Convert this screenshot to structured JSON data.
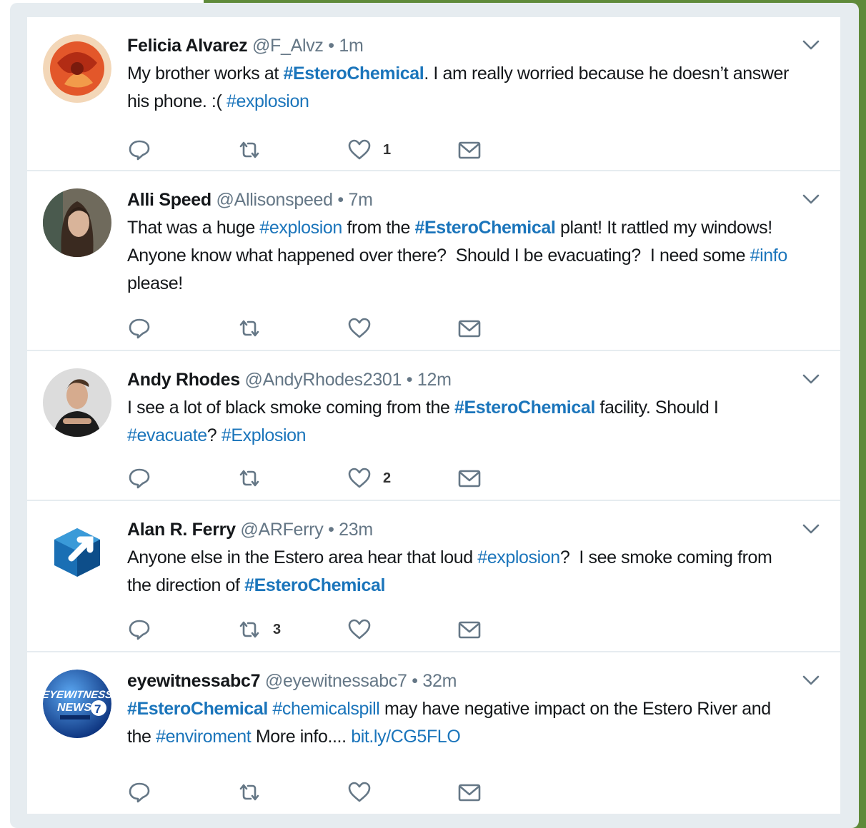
{
  "tweets": [
    {
      "name": "Felicia Alvarez",
      "handle": "@F_Alvz",
      "time": "1m",
      "text": [
        {
          "t": "My brother works at "
        },
        {
          "t": "#EsteroChemical",
          "tag": "bold"
        },
        {
          "t": ". I am really worried because he doesn’t answer his phone. :( "
        },
        {
          "t": "#explosion",
          "tag": "normal"
        }
      ],
      "reply_count": "",
      "retweet_count": "",
      "like_count": "1",
      "avatar": "red-flower-avatar"
    },
    {
      "name": "Alli Speed",
      "handle": "@Allisonspeed",
      "time": "7m",
      "text": [
        {
          "t": "That was a huge "
        },
        {
          "t": "#explosion",
          "tag": "normal"
        },
        {
          "t": " from the "
        },
        {
          "t": "#EsteroChemical",
          "tag": "bold"
        },
        {
          "t": " plant! It rattled my windows!  Anyone know what happened over there?  Should I be evacuating?  I need some "
        },
        {
          "t": "#info",
          "tag": "normal"
        },
        {
          "t": " please!"
        }
      ],
      "reply_count": "",
      "retweet_count": "",
      "like_count": "",
      "avatar": "woman-portrait-avatar"
    },
    {
      "name": "Andy Rhodes",
      "handle": "@AndyRhodes2301",
      "time": "12m",
      "text": [
        {
          "t": "I see a lot of black smoke coming from the "
        },
        {
          "t": "#EsteroChemical",
          "tag": "bold"
        },
        {
          "t": " facility. Should I "
        },
        {
          "t": "#evacuate",
          "tag": "normal"
        },
        {
          "t": "? "
        },
        {
          "t": "#Explosion",
          "tag": "normal"
        }
      ],
      "reply_count": "",
      "retweet_count": "",
      "like_count": "2",
      "avatar": "man-portrait-avatar"
    },
    {
      "name": "Alan R. Ferry",
      "handle": "@ARFerry",
      "time": "23m",
      "text": [
        {
          "t": "Anyone else in the Estero area hear that loud "
        },
        {
          "t": "#explosion",
          "tag": "normal"
        },
        {
          "t": "?  I see smoke coming from the direction of "
        },
        {
          "t": "#EsteroChemical",
          "tag": "bold"
        }
      ],
      "reply_count": "",
      "retweet_count": "3",
      "like_count": "",
      "avatar": "blue-cube-avatar"
    },
    {
      "name": "eyewitnessabc7",
      "handle": "@eyewitnessabc7",
      "time": "32m",
      "text": [
        {
          "t": "#EsteroChemical",
          "tag": "bold"
        },
        {
          "t": " "
        },
        {
          "t": "#chemicalspill",
          "tag": "normal"
        },
        {
          "t": " may have negative impact on the Estero River and the "
        },
        {
          "t": "#enviroment",
          "tag": "normal"
        },
        {
          "t": " More info.... "
        },
        {
          "t": "bit.ly/CG5FLO",
          "tag": "normal"
        }
      ],
      "reply_count": "",
      "retweet_count": "",
      "like_count": "",
      "avatar": "eyewitness-news-logo",
      "logo_text": [
        "EYEWITNESS",
        "NEWS",
        "7"
      ]
    }
  ],
  "separator": " • ",
  "colors": {
    "link": "#1b75bb",
    "name": "#14171a",
    "meta": "#657786",
    "icon": "#657786",
    "panel": "#e6ecf0",
    "frame_green": "#5f8a3a"
  }
}
